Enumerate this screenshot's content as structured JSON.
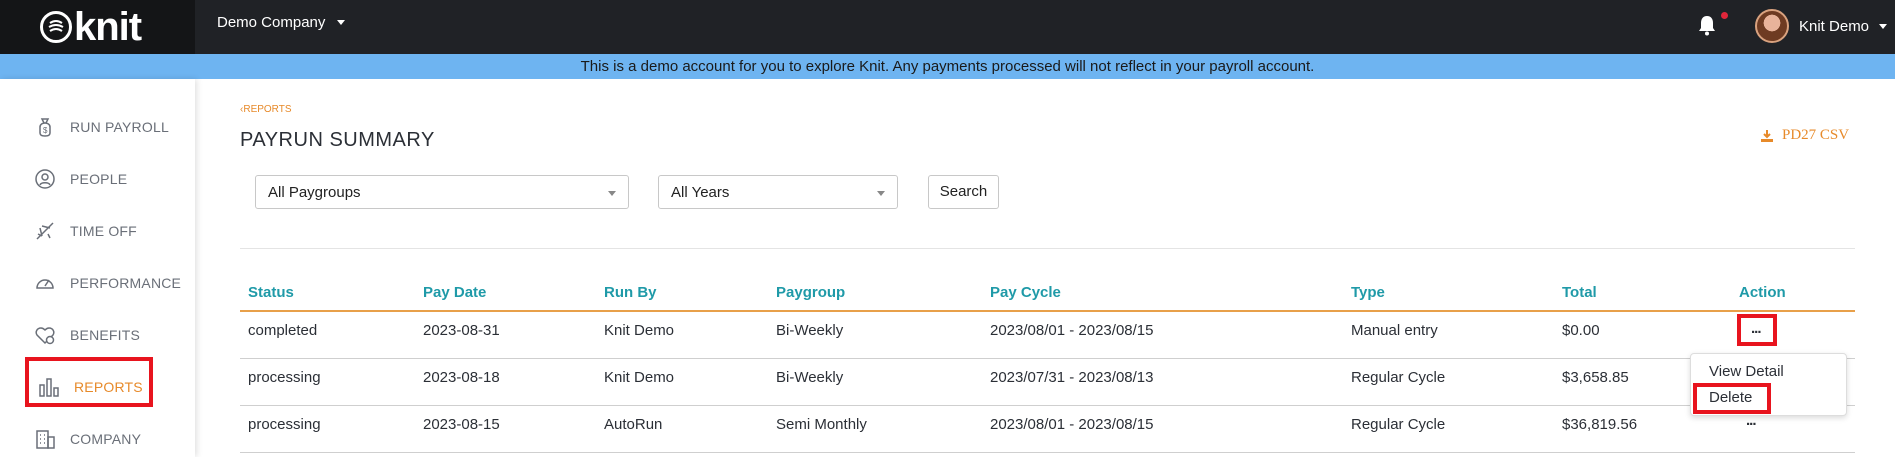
{
  "topbar": {
    "logo": "knit",
    "company": "Demo Company",
    "user_name": "Knit Demo"
  },
  "banner": "This is a demo account for you to explore Knit. Any payments processed will not reflect in your payroll account.",
  "sidebar": {
    "items": [
      {
        "label": "RUN PAYROLL",
        "icon": "money-bag-icon"
      },
      {
        "label": "PEOPLE",
        "icon": "person-icon"
      },
      {
        "label": "TIME OFF",
        "icon": "airplane-icon"
      },
      {
        "label": "PERFORMANCE",
        "icon": "gauge-icon"
      },
      {
        "label": "BENEFITS",
        "icon": "heart-shield-icon"
      },
      {
        "label": "REPORTS",
        "icon": "bar-chart-icon",
        "active": true
      },
      {
        "label": "COMPANY",
        "icon": "building-icon"
      }
    ]
  },
  "main": {
    "breadcrumb": "REPORTS",
    "title": "PAYRUN SUMMARY",
    "export_label": "PD27 CSV",
    "filters": {
      "paygroup": "All Paygroups",
      "year": "All Years",
      "search_label": "Search"
    },
    "table": {
      "headers": [
        "Status",
        "Pay Date",
        "Run By",
        "Paygroup",
        "Pay Cycle",
        "Type",
        "Total",
        "Action"
      ],
      "rows": [
        {
          "status": "completed",
          "pay_date": "2023-08-31",
          "run_by": "Knit Demo",
          "paygroup": "Bi-Weekly",
          "pay_cycle": "2023/08/01 - 2023/08/15",
          "type": "Manual entry",
          "total": "$0.00",
          "action": "..."
        },
        {
          "status": "processing",
          "pay_date": "2023-08-18",
          "run_by": "Knit Demo",
          "paygroup": "Bi-Weekly",
          "pay_cycle": "2023/07/31 - 2023/08/13",
          "type": "Regular Cycle",
          "total": "$3,658.85",
          "action": "..."
        },
        {
          "status": "processing",
          "pay_date": "2023-08-15",
          "run_by": "AutoRun",
          "paygroup": "Semi Monthly",
          "pay_cycle": "2023/08/01 - 2023/08/15",
          "type": "Regular Cycle",
          "total": "$36,819.56",
          "action": "..."
        }
      ]
    },
    "action_menu": {
      "view_detail": "View Detail",
      "delete": "Delete"
    }
  },
  "colors": {
    "accent": "#e78a2a",
    "header_teal": "#1f9aa8",
    "banner": "#6eb4f1",
    "topbar": "#202226",
    "highlight": "#e8141e"
  }
}
